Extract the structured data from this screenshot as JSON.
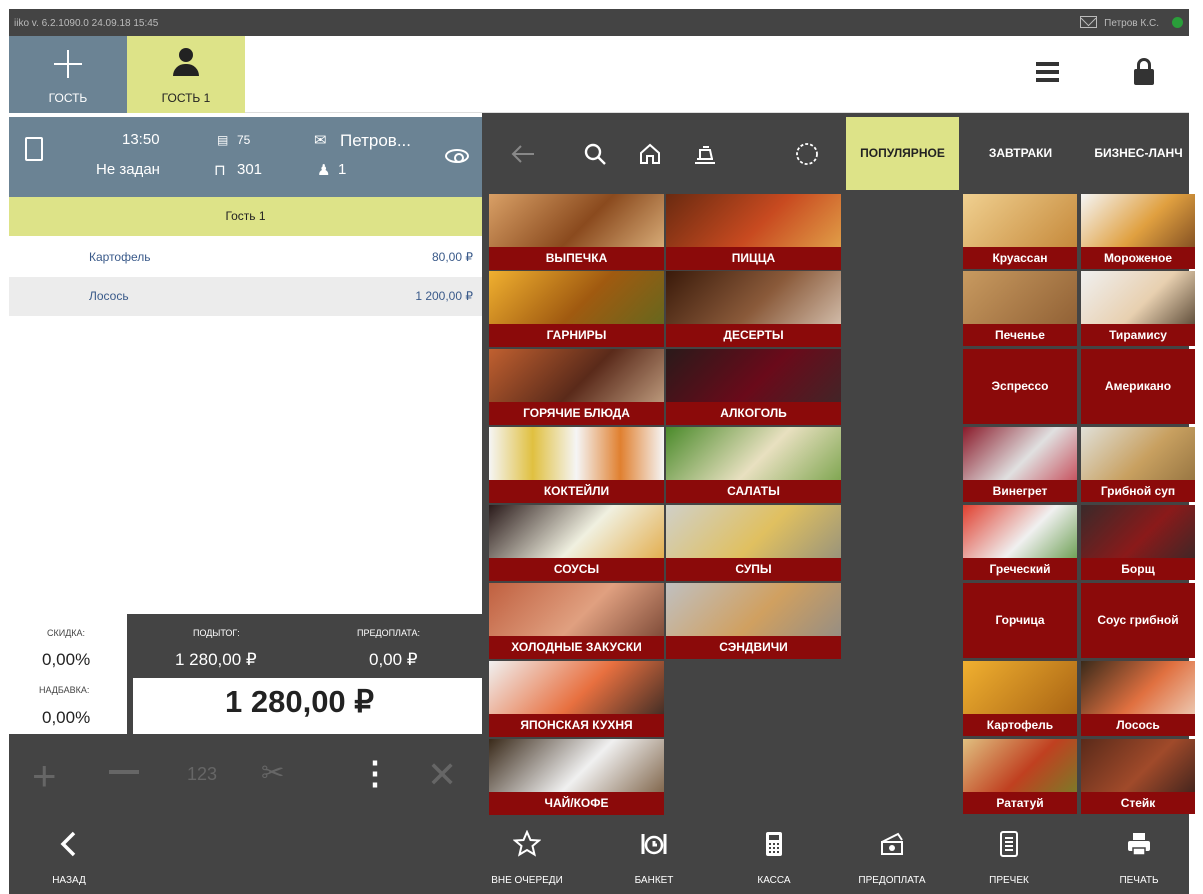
{
  "topbar": {
    "version": "iiko  v. 6.2.1090.0    24.09.18  15:45",
    "user": "Петров К.С."
  },
  "guest_tabs": [
    {
      "label": "ГОСТЬ"
    },
    {
      "label": "ГОСТЬ 1"
    }
  ],
  "order": {
    "time": "13:50",
    "status": "Не задан",
    "order_no": "75",
    "table": "301",
    "waiter": "Петров...",
    "guests": "1",
    "guest_label": "Гость 1",
    "items": [
      {
        "name": "Картофель",
        "price": "80,00 ₽"
      },
      {
        "name": "Лосось",
        "price": "1 200,00 ₽"
      }
    ]
  },
  "totals": {
    "discount_label": "СКИДКА:",
    "discount": "0,00%",
    "surcharge_label": "НАДБАВКА:",
    "surcharge": "0,00%",
    "subtotal_label": "ПОДЫТОГ:",
    "subtotal": "1 280,00 ₽",
    "prepay_label": "ПРЕДОПЛАТА:",
    "prepay": "0,00 ₽",
    "total": "1 280,00 ₽"
  },
  "actions": {
    "num_label": "123"
  },
  "category_tabs": [
    {
      "label": "ПОПУЛЯРНОЕ"
    },
    {
      "label": "ЗАВТРАКИ"
    },
    {
      "label": "БИЗНЕС-ЛАНЧ"
    }
  ],
  "categories": [
    "ВЫПЕЧКА",
    "ПИЦЦА",
    "ГАРНИРЫ",
    "ДЕСЕРТЫ",
    "ГОРЯЧИЕ БЛЮДА",
    "АЛКОГОЛЬ",
    "КОКТЕЙЛИ",
    "САЛАТЫ",
    "СОУСЫ",
    "СУПЫ",
    "ХОЛОДНЫЕ ЗАКУСКИ",
    "СЭНДВИЧИ",
    "ЯПОНСКАЯ КУХНЯ",
    "ЧАЙ/КОФЕ"
  ],
  "popular": [
    "Круассан",
    "Мороженое",
    "Печенье",
    "Тирамису",
    "Эспрессо",
    "Американо",
    "Винегрет",
    "Грибной суп",
    "Греческий",
    "Борщ",
    "Горчица",
    "Соус грибной",
    "Картофель",
    "Лосось",
    "Рататуй",
    "Стейк"
  ],
  "bottom": {
    "back": "НАЗАД",
    "priority": "ВНЕ ОЧЕРЕДИ",
    "banquet": "БАНКЕТ",
    "cash": "КАССА",
    "prepay": "ПРЕДОПЛАТА",
    "precheck": "ПРЕЧЕК",
    "print": "ПЕЧАТЬ"
  },
  "colors": {
    "accent": "#dde388",
    "header": "#6b8394",
    "dark": "#444444",
    "tile": "#8b0a0a"
  }
}
